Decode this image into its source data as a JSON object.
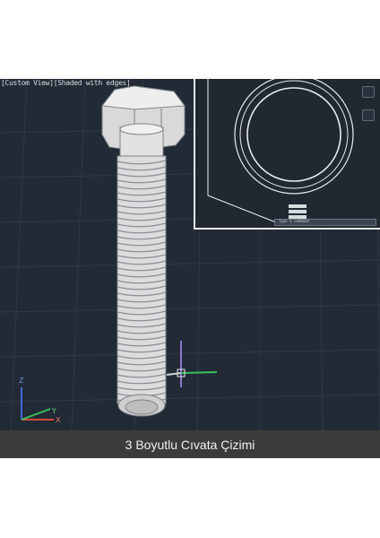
{
  "viewport": {
    "view_label": "[Custom View][Shaded with edges]"
  },
  "inset": {
    "command_placeholder": "Type a command"
  },
  "ucs_icon": {
    "x_label": "X",
    "y_label": "Y",
    "z_label": "Z"
  },
  "caption": {
    "text": "3 Boyutlu Cıvata Çizimi"
  },
  "colors": {
    "viewport_bg": "#222a35",
    "grid_line": "#2e3743",
    "bolt_face": "#e6e6e6",
    "caption_bg": "#3b3b3b"
  }
}
